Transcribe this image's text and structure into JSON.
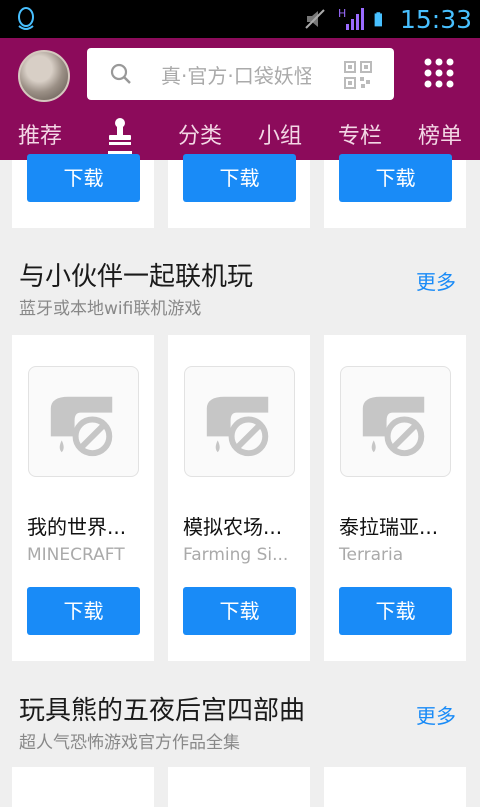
{
  "status_bar": {
    "time": "15:33",
    "left_icon": "qq-penguin-icon",
    "icons": [
      "mute-icon",
      "signal-h-icon",
      "battery-icon"
    ]
  },
  "header": {
    "search_placeholder": "真·官方·口袋妖怪",
    "tabs": [
      "推荐",
      "分类",
      "小组",
      "专栏",
      "榜单"
    ],
    "active_tab_icon": "stamp-icon"
  },
  "top_row": {
    "download_label": "下载"
  },
  "sections": [
    {
      "title": "与小伙伴一起联机玩",
      "subtitle": "蓝牙或本地wifi联机游戏",
      "more": "更多",
      "games": [
        {
          "name": "我的世界...",
          "en": "MINECRAFT",
          "download": "下载"
        },
        {
          "name": "模拟农场...",
          "en": "Farming Si...",
          "download": "下载"
        },
        {
          "name": "泰拉瑞亚...",
          "en": "Terraria",
          "download": "下载"
        }
      ]
    },
    {
      "title": "玩具熊的五夜后宫四部曲",
      "subtitle": "超人气恐怖游戏官方作品全集",
      "more": "更多"
    }
  ],
  "colors": {
    "header": "#8c0b5b",
    "accent": "#198bf7",
    "background": "#efefef"
  }
}
